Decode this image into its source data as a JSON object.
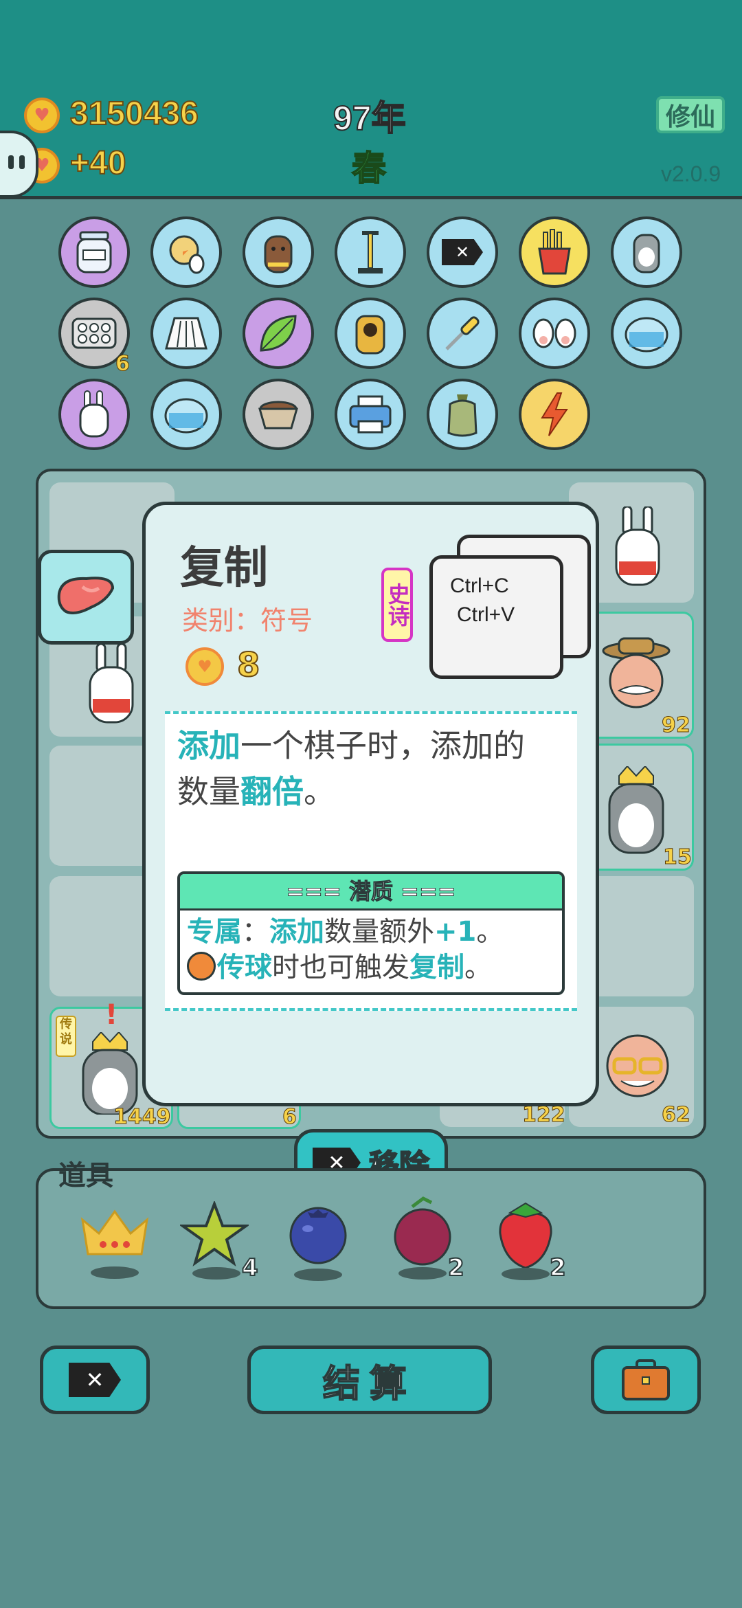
{
  "header": {
    "coins": "3150436",
    "income": "+40",
    "year": "97年",
    "season": "春",
    "cultivate_button": "修仙",
    "version": "v2.0.9"
  },
  "chip_grid": {
    "counts": [
      "6"
    ]
  },
  "board": {
    "counts": [
      "92",
      "15",
      "1449",
      "6",
      "122",
      "62"
    ],
    "legendary_tag": "传说"
  },
  "card": {
    "title": "复制",
    "type_label": "类别：符号",
    "cost": "8",
    "rarity": "史诗",
    "key_line1": "Ctrl+C",
    "key_line2": "Ctrl+V",
    "desc_1_hl": "添加",
    "desc_1": "一个棋子时，添加的",
    "desc_2": "数量",
    "desc_2_hl": "翻倍",
    "desc_2_end": "。",
    "trait_header": "=== 潜质 ===",
    "trait_l1_a_hl": "专属",
    "trait_l1_b": "：",
    "trait_l1_c_hl": "添加",
    "trait_l1_d": "数量额外",
    "trait_l1_e_hl": "+1",
    "trait_l1_f": "。",
    "trait_l2_a_hl": "传球",
    "trait_l2_b": "时也可触发",
    "trait_l2_c_hl": "复制",
    "trait_l2_d": "。"
  },
  "remove_button": {
    "label": "移除"
  },
  "items": {
    "label": "道具",
    "list": [
      {
        "icon": "crown-icon",
        "count": ""
      },
      {
        "icon": "star-icon",
        "count": "4"
      },
      {
        "icon": "blueberry-icon",
        "count": ""
      },
      {
        "icon": "bayberry-icon",
        "count": "2"
      },
      {
        "icon": "strawberry-icon",
        "count": "2"
      }
    ]
  },
  "bottom": {
    "settle_label": "结算",
    "remove_icon": "x-tag-icon",
    "bag_icon": "briefcase-icon"
  },
  "colors": {
    "header_bg": "#1e8f86",
    "accent_teal": "#33b8b8",
    "highlight": "#27b3b8",
    "rarity_epic": "#c42cc0",
    "coin_gold": "#f6d24a"
  }
}
